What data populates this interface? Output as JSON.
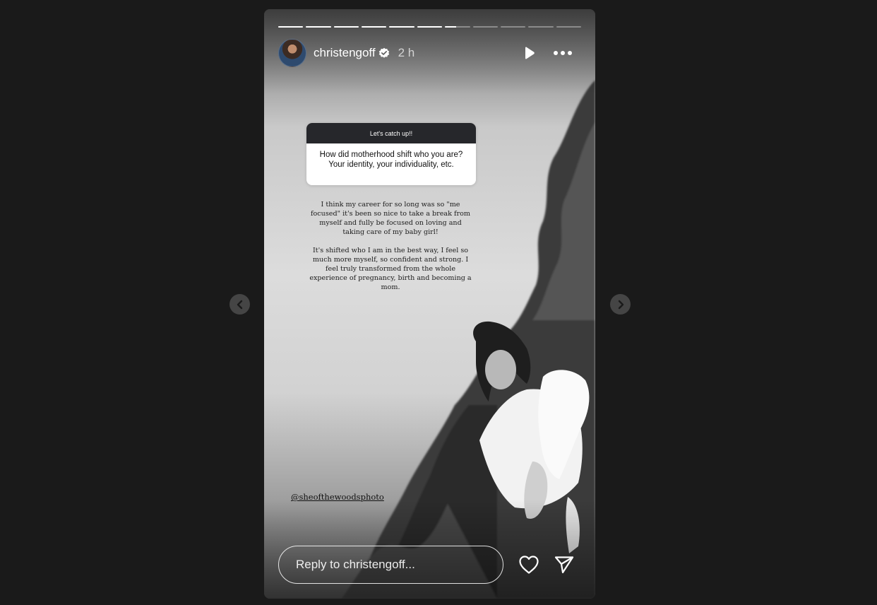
{
  "story": {
    "progress_segments": [
      1,
      1,
      1,
      1,
      1,
      1,
      0.45,
      0,
      0,
      0,
      0
    ],
    "header": {
      "username": "christengoff",
      "time": "2 h",
      "avatar_icon": "profile-photo",
      "verified_icon": "verified-badge-icon",
      "play_icon": "play-icon",
      "more_icon": "more-horizontal-icon"
    },
    "question": {
      "prompt": "Let's catch up!!",
      "text_line1": "How did motherhood shift who you are?",
      "text_line2": "Your identity, your individuality, etc."
    },
    "answer": {
      "paragraph1": "I think my career for so long was so \"me focused\" it's been so nice to take a break from myself and fully be focused on loving and taking care of my baby girl!",
      "paragraph2": "It's shifted who I am in the best way, I feel so much more myself, so confident and strong. I feel truly transformed from the whole experience of pregnancy, birth and becoming a mom."
    },
    "credit": "@sheofthewoodsphoto",
    "reply": {
      "placeholder": "Reply to christengoff...",
      "like_icon": "heart-icon",
      "share_icon": "send-icon"
    }
  },
  "navigation": {
    "prev_icon": "chevron-left-icon",
    "next_icon": "chevron-right-icon"
  }
}
